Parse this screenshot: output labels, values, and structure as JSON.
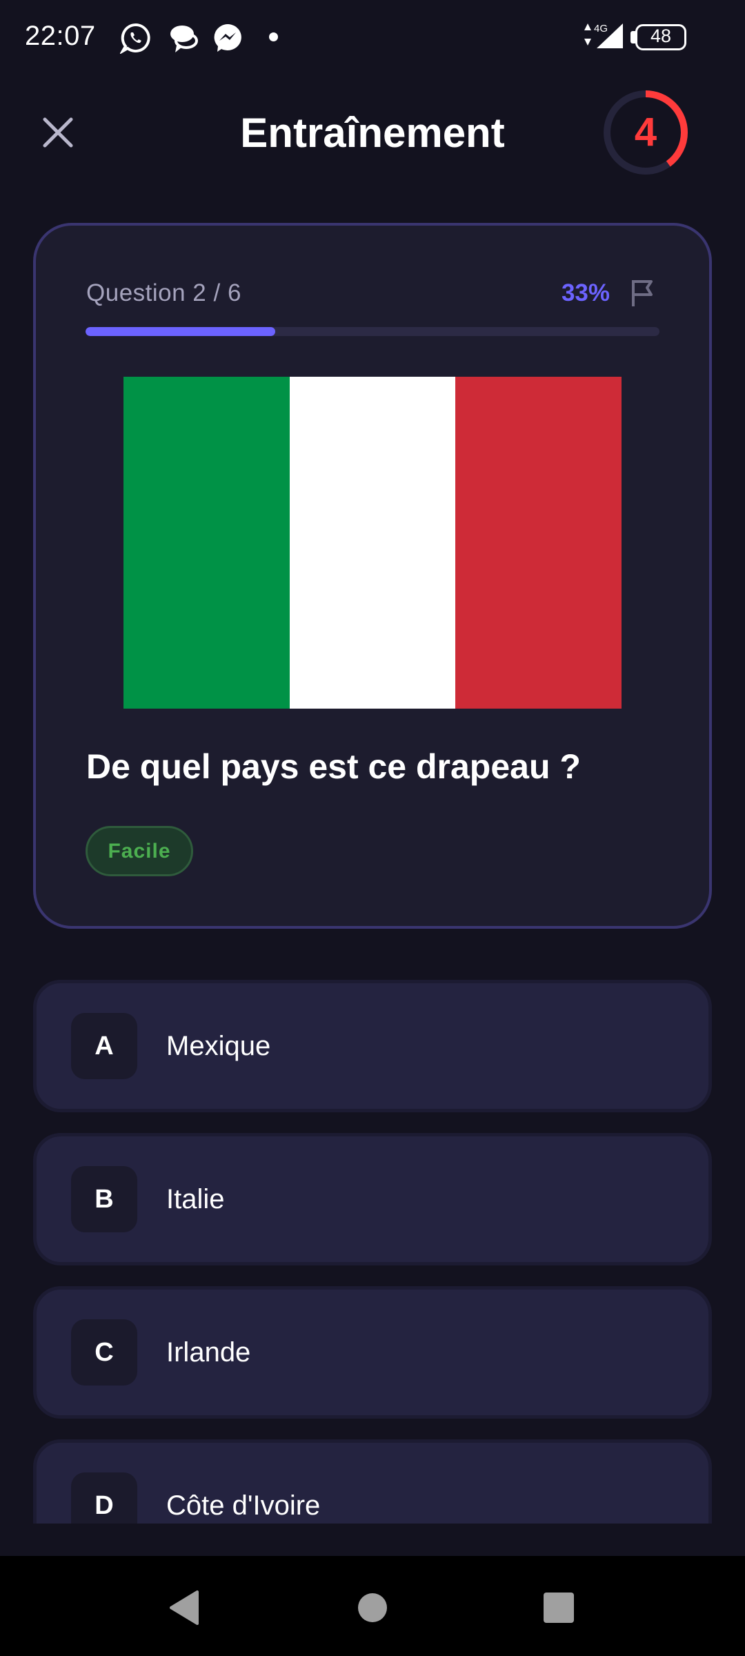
{
  "status_bar": {
    "time": "22:07",
    "network": "4G",
    "battery": "48",
    "icons": [
      "whatsapp-icon",
      "chat-bubbles-icon",
      "messenger-icon",
      "notification-dot-icon",
      "signal-icon",
      "battery-icon"
    ]
  },
  "header": {
    "title": "Entraînement",
    "timer_value": "4",
    "timer_remaining_fraction": 0.4,
    "timer_color": "#ff3b3b"
  },
  "quiz": {
    "counter": "Question 2 / 6",
    "percent": "33%",
    "progress": 0.33,
    "accent_color": "#6c63ff",
    "flag_colors": [
      "#009246",
      "#ffffff",
      "#ce2b37"
    ],
    "question": "De quel pays est ce drapeau ?",
    "difficulty": "Facile",
    "difficulty_color": "#4caf50"
  },
  "answers": [
    {
      "letter": "A",
      "text": "Mexique"
    },
    {
      "letter": "B",
      "text": "Italie"
    },
    {
      "letter": "C",
      "text": "Irlande"
    },
    {
      "letter": "D",
      "text": "Côte d'Ivoire"
    }
  ]
}
